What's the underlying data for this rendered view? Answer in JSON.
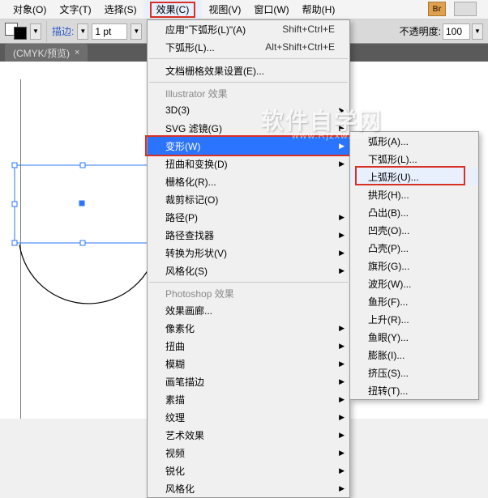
{
  "menubar": {
    "object": "对象(O)",
    "type": "文字(T)",
    "select": "选择(S)",
    "effect": "效果(C)",
    "view": "视图(V)",
    "window": "窗口(W)",
    "help": "帮助(H)"
  },
  "toolbar": {
    "stroke_label": "描边:",
    "stroke_value": "1 pt",
    "opacity_label": "不透明度:",
    "opacity_value": "100",
    "br_badge": "Br"
  },
  "tab": {
    "title": "(CMYK/预览)",
    "close": "×"
  },
  "effect_menu": {
    "apply_last": "应用\"下弧形(L)\"(A)",
    "apply_last_sc": "Shift+Ctrl+E",
    "last_effect": "下弧形(L)...",
    "last_effect_sc": "Alt+Shift+Ctrl+E",
    "doc_raster": "文档栅格效果设置(E)...",
    "head_ai": "Illustrator 效果",
    "three_d": "3D(3)",
    "svg_filter": "SVG 滤镜(G)",
    "warp": "变形(W)",
    "distort": "扭曲和变换(D)",
    "rasterize": "栅格化(R)...",
    "crop": "裁剪标记(O)",
    "path": "路径(P)",
    "pathfinder": "路径查找器",
    "convert": "转换为形状(V)",
    "stylize_ai": "风格化(S)",
    "head_ps": "Photoshop 效果",
    "gallery": "效果画廊...",
    "pixelate": "像素化",
    "distort_ps": "扭曲",
    "blur": "模糊",
    "brush": "画笔描边",
    "sketch": "素描",
    "texture": "纹理",
    "artistic": "艺术效果",
    "video": "视频",
    "sharpen": "锐化",
    "stylize_ps": "风格化"
  },
  "warp_submenu": {
    "arc": "弧形(A)...",
    "arc_lower": "下弧形(L)...",
    "arc_upper": "上弧形(U)...",
    "arch": "拱形(H)...",
    "bulge": "凸出(B)...",
    "shell_lower": "凹壳(O)...",
    "shell_upper": "凸壳(P)...",
    "flag": "旗形(G)...",
    "wave": "波形(W)...",
    "fish": "鱼形(F)...",
    "rise": "上升(R)...",
    "fisheye": "鱼眼(Y)...",
    "inflate": "膨胀(I)...",
    "squeeze": "挤压(S)...",
    "twist": "扭转(T)..."
  },
  "watermark": {
    "main": "软件自学网",
    "sub": "www.Rjzxw.com"
  }
}
